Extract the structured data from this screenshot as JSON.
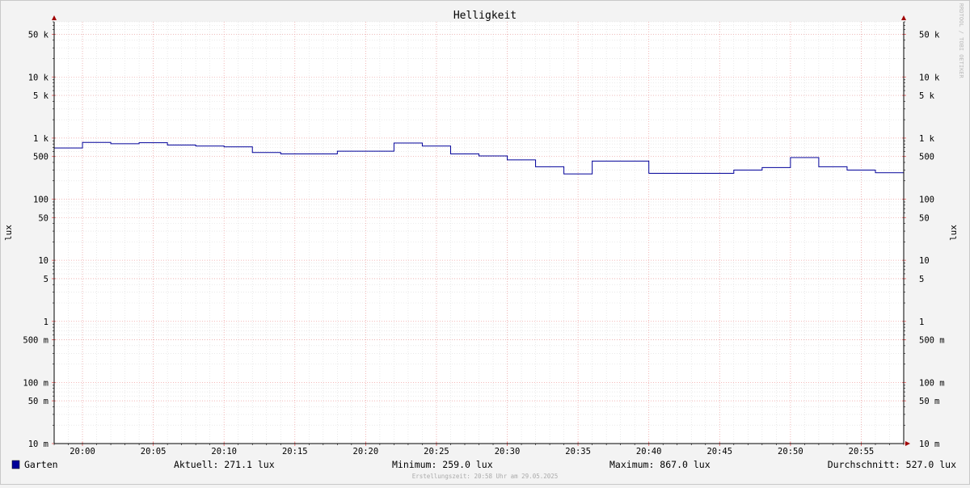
{
  "chart_data": {
    "type": "line",
    "title": "Helligkeit",
    "ylabel": "lux",
    "watermark": "RRDTOOL / TOBI OETIKER",
    "yscale": "log",
    "ylim": [
      10,
      80000
    ],
    "x_ticks": [
      "20:00",
      "20:05",
      "20:10",
      "20:15",
      "20:20",
      "20:25",
      "20:30",
      "20:35",
      "20:40",
      "20:45",
      "20:50",
      "20:55"
    ],
    "y_ticks": [
      {
        "value": 0.01,
        "label": "10 m"
      },
      {
        "value": 0.05,
        "label": "50 m"
      },
      {
        "value": 0.1,
        "label": "100 m"
      },
      {
        "value": 0.5,
        "label": "500 m"
      },
      {
        "value": 1,
        "label": "1"
      },
      {
        "value": 5,
        "label": "5"
      },
      {
        "value": 10,
        "label": "10"
      },
      {
        "value": 50,
        "label": "50"
      },
      {
        "value": 100,
        "label": "100"
      },
      {
        "value": 500,
        "label": "500"
      },
      {
        "value": 1000,
        "label": "1 k"
      },
      {
        "value": 5000,
        "label": "5 k"
      },
      {
        "value": 10000,
        "label": "10 k"
      },
      {
        "value": 50000,
        "label": "50 k"
      }
    ],
    "series": [
      {
        "name": "Garten",
        "color": "#000099",
        "x": [
          "19:58",
          "20:00",
          "20:02",
          "20:04",
          "20:06",
          "20:08",
          "20:10",
          "20:12",
          "20:14",
          "20:16",
          "20:18",
          "20:20",
          "20:22",
          "20:24",
          "20:26",
          "20:28",
          "20:30",
          "20:32",
          "20:34",
          "20:36",
          "20:38",
          "20:40",
          "20:42",
          "20:44",
          "20:46",
          "20:48",
          "20:50",
          "20:52",
          "20:54",
          "20:56",
          "20:58"
        ],
        "values": [
          690,
          850,
          810,
          840,
          770,
          740,
          720,
          580,
          550,
          550,
          610,
          610,
          830,
          740,
          550,
          510,
          440,
          340,
          259,
          420,
          420,
          265,
          265,
          265,
          300,
          330,
          480,
          340,
          300,
          271,
          271
        ]
      }
    ]
  },
  "legend": {
    "series_name": "Garten",
    "swatch_color": "#000099",
    "aktuell": "Aktuell: 271.1 lux",
    "minimum": "Minimum: 259.0 lux",
    "maximum": "Maximum: 867.0 lux",
    "durchschnitt": "Durchschnitt: 527.0 lux"
  },
  "footer": "Erstellungszeit: 20:58 Uhr am 29.05.2025"
}
